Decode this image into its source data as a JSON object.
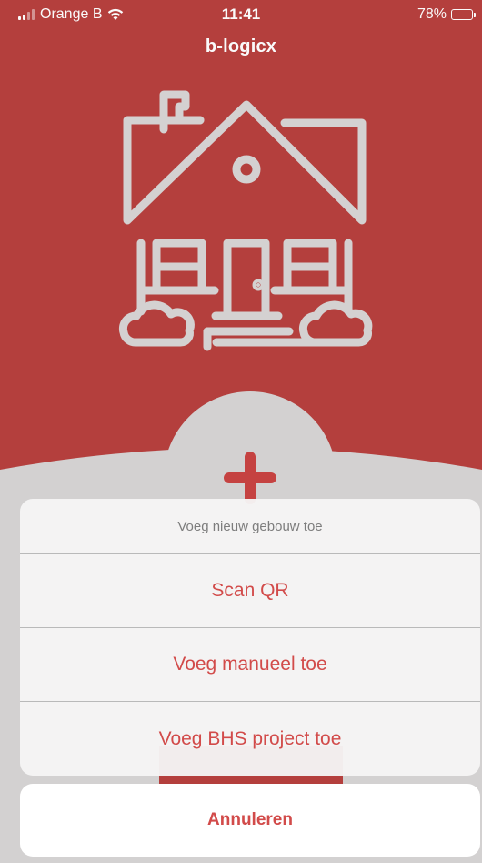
{
  "status_bar": {
    "carrier": "Orange B",
    "time": "11:41",
    "battery_text": "78%",
    "battery_level": 0.78
  },
  "header": {
    "app_title": "b-logicx"
  },
  "colors": {
    "brand_red": "#b8413f",
    "accent_red": "#d24b4a",
    "plus_red": "#c94443",
    "house_outline": "#d9d6d6"
  },
  "icons": {
    "house": "house-illustration-icon",
    "add": "plus-icon",
    "wifi": "wifi-icon",
    "signal": "cellular-signal-icon",
    "battery": "battery-icon"
  },
  "action_sheet": {
    "title": "Voeg nieuw gebouw toe",
    "options": [
      {
        "label": "Scan QR"
      },
      {
        "label": "Voeg manueel toe"
      },
      {
        "label": "Voeg BHS project toe"
      }
    ],
    "cancel_label": "Annuleren"
  }
}
